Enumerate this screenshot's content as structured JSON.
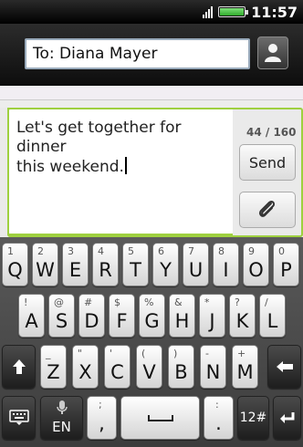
{
  "status_bar": {
    "time": "11:57",
    "icons": [
      "signal-icon",
      "battery-icon"
    ],
    "battery_level": 1.0
  },
  "recipient": {
    "value": "To: Diana Mayer",
    "contact_icon": "contact-person-icon"
  },
  "compose": {
    "message_line1": "Let's get together for dinner",
    "message_line2": "this weekend.",
    "counter": "44 / 160",
    "send_label": "Send",
    "attach_icon": "paperclip-icon"
  },
  "keyboard": {
    "row1": [
      {
        "sub": "1",
        "main": "Q"
      },
      {
        "sub": "2",
        "main": "W"
      },
      {
        "sub": "3",
        "main": "E"
      },
      {
        "sub": "4",
        "main": "R"
      },
      {
        "sub": "5",
        "main": "T"
      },
      {
        "sub": "6",
        "main": "Y"
      },
      {
        "sub": "7",
        "main": "U"
      },
      {
        "sub": "8",
        "main": "I"
      },
      {
        "sub": "9",
        "main": "O"
      },
      {
        "sub": "0",
        "main": "P"
      }
    ],
    "row2": [
      {
        "sub": "!",
        "main": "A"
      },
      {
        "sub": "@",
        "main": "S"
      },
      {
        "sub": "#",
        "main": "D"
      },
      {
        "sub": "$",
        "main": "F"
      },
      {
        "sub": "%",
        "main": "G"
      },
      {
        "sub": "&",
        "main": "H"
      },
      {
        "sub": "*",
        "main": "J"
      },
      {
        "sub": "?",
        "main": "K"
      },
      {
        "sub": "/",
        "main": "L"
      }
    ],
    "row3": [
      {
        "sub": "_",
        "main": "Z"
      },
      {
        "sub": "\"",
        "main": "X"
      },
      {
        "sub": "'",
        "main": "C"
      },
      {
        "sub": "(",
        "main": "V"
      },
      {
        "sub": ")",
        "main": "B"
      },
      {
        "sub": "-",
        "main": "N"
      },
      {
        "sub": "+",
        "main": "M"
      }
    ],
    "row4": {
      "lang": "EN",
      "comma_sub": ";",
      "comma": ",",
      "period_sub": ":",
      "period": ".",
      "sym_label": "12#"
    },
    "icons": [
      "shift-icon",
      "backspace-icon",
      "keyboard-hide-icon",
      "microphone-icon",
      "space-icon",
      "enter-icon"
    ]
  },
  "colors": {
    "accent_green": "#9ed03f",
    "status_bar": "#000000"
  }
}
